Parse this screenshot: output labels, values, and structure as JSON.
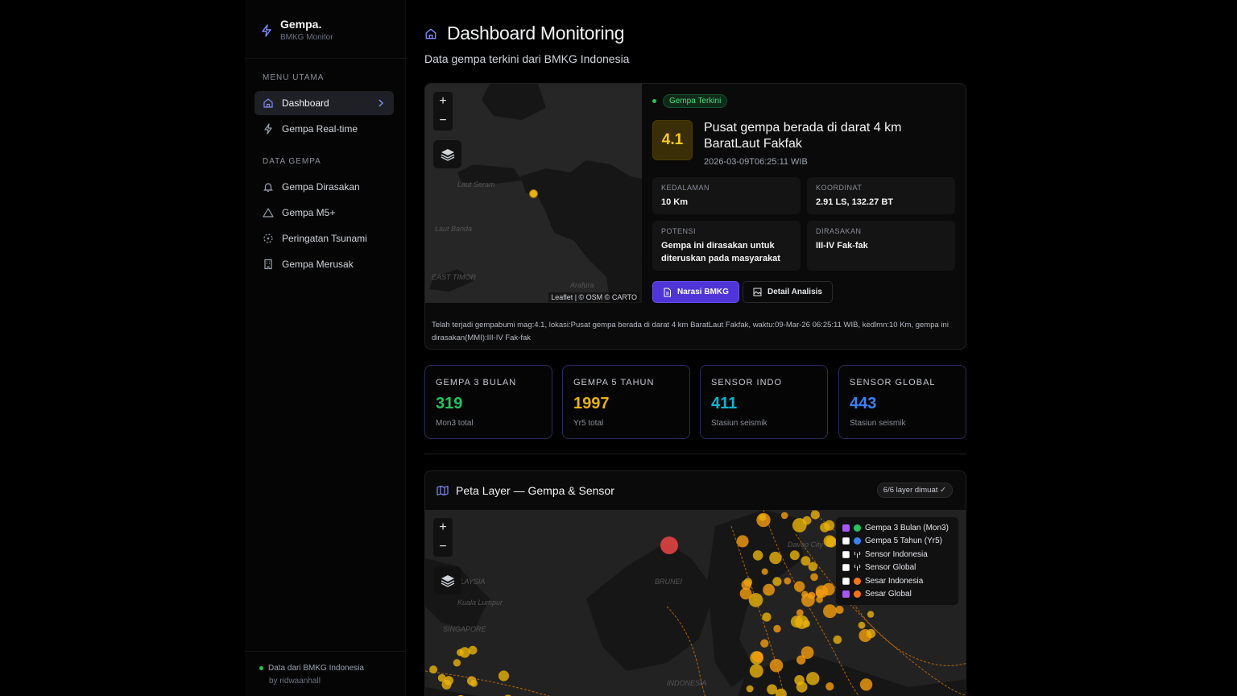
{
  "brand": {
    "name": "Gempa.",
    "subtitle": "BMKG Monitor"
  },
  "sidebar": {
    "section_main": "MENU UTAMA",
    "main_items": [
      {
        "label": "Dashboard",
        "icon": "home-icon",
        "active": true
      },
      {
        "label": "Gempa Real-time",
        "icon": "bolt-icon",
        "active": false
      }
    ],
    "section_data": "DATA GEMPA",
    "data_items": [
      {
        "label": "Gempa Dirasakan",
        "icon": "bell-icon"
      },
      {
        "label": "Gempa M5+",
        "icon": "warning-icon"
      },
      {
        "label": "Peringatan Tsunami",
        "icon": "radar-icon"
      },
      {
        "label": "Gempa Merusak",
        "icon": "building-icon"
      }
    ],
    "footer": {
      "source": "Data dari BMKG Indonesia",
      "author": "by ridwaanhall"
    }
  },
  "header": {
    "title": "Dashboard Monitoring",
    "subtitle": "Data gempa terkini dari BMKG Indonesia"
  },
  "latest": {
    "badge": "Gempa Terkini",
    "magnitude": "4.1",
    "location": "Pusat gempa berada di darat 4 km BaratLaut Fakfak",
    "datetime": "2026-03-09T06:25:11 WIB",
    "depth_label": "KEDALAMAN",
    "depth": "10 Km",
    "coord_label": "KOORDINAT",
    "coord": "2.91 LS, 132.27 BT",
    "potential_label": "POTENSI",
    "potential": "Gempa ini dirasakan untuk diteruskan pada masyarakat",
    "felt_label": "DIRASAKAN",
    "felt": "III-IV Fak-fak",
    "btn_narasi": "Narasi BMKG",
    "btn_detail": "Detail Analisis",
    "narrative": "Telah terjadi gempabumi mag:4.1, lokasi:Pusat gempa berada di darat 4 km BaratLaut Fakfak, waktu:09-Mar-26 06:25:11 WIB, kedlmn:10 Km, gempa ini dirasakan(MMI):III-IV Fak-fak"
  },
  "minimap": {
    "attribution": "Leaflet | © OSM © CARTO",
    "labels": [
      "Laut Seram",
      "Laut Banda",
      "EAST TIMOR",
      "Arafura"
    ],
    "zoom_in": "+",
    "zoom_out": "−"
  },
  "stats": [
    {
      "label": "GEMPA 3 BULAN",
      "value": "319",
      "sub": "Mon3 total",
      "color": "#22c55e"
    },
    {
      "label": "GEMPA 5 TAHUN",
      "value": "1997",
      "sub": "Yr5 total",
      "color": "#eab308"
    },
    {
      "label": "SENSOR INDO",
      "value": "411",
      "sub": "Stasiun seismik",
      "color": "#06b6d4"
    },
    {
      "label": "SENSOR GLOBAL",
      "value": "443",
      "sub": "Stasiun seismik",
      "color": "#3b82f6"
    }
  ],
  "layer_map": {
    "title": "Peta Layer — Gempa & Sensor",
    "status": "6/6 layer dimuat ✓",
    "labels": [
      "MALAYSIA",
      "Kuala Lumpur",
      "SINGAPORE",
      "BRUNEI",
      "INDONESIA",
      "Davao City"
    ],
    "legend": [
      {
        "label": "Gempa 3 Bulan (Mon3)",
        "checked": true,
        "color": "#22c55e",
        "icon": "dot"
      },
      {
        "label": "Gempa 5 Tahun (Yr5)",
        "checked": false,
        "color": "#3b82f6",
        "icon": "dot"
      },
      {
        "label": "Sensor Indonesia",
        "checked": false,
        "color": "#e5e7eb",
        "icon": "antenna-icon"
      },
      {
        "label": "Sensor Global",
        "checked": false,
        "color": "#e5e7eb",
        "icon": "antenna-icon"
      },
      {
        "label": "Sesar Indonesia",
        "checked": false,
        "color": "#f97316",
        "icon": "dot"
      },
      {
        "label": "Sesar Global",
        "checked": true,
        "color": "#f97316",
        "icon": "dot"
      }
    ]
  }
}
